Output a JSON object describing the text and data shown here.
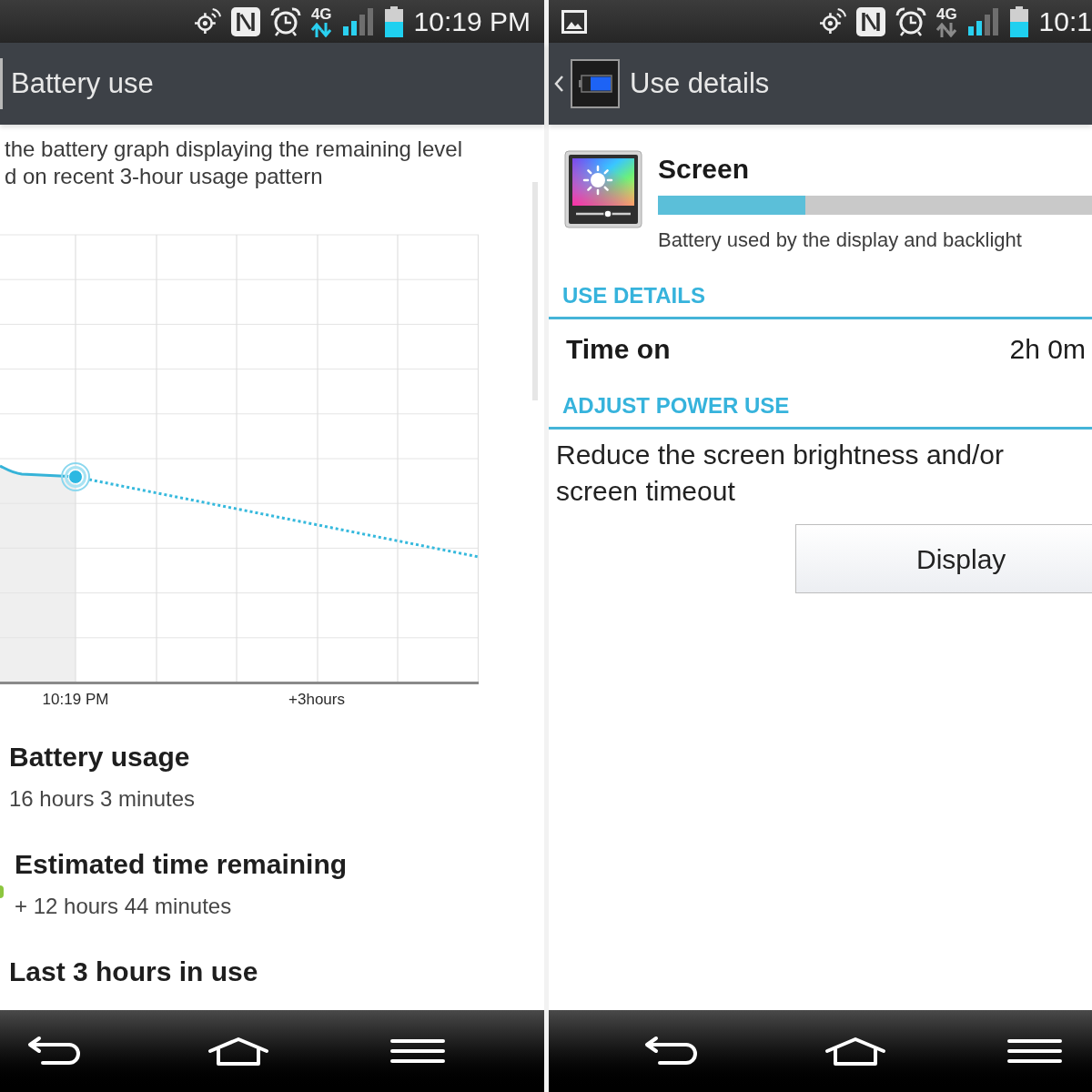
{
  "left_screen": {
    "status_bar": {
      "network": "4G",
      "data_active": true,
      "time": "10:19 PM"
    },
    "header": {
      "title": "Battery use"
    },
    "description_lines": [
      "the battery graph displaying the remaining level",
      "d on recent 3-hour usage pattern"
    ],
    "chart": {
      "x_labels": [
        "10:19 PM",
        "+3hours"
      ]
    },
    "stats": [
      {
        "title": "Battery usage",
        "value": "16 hours 3 minutes"
      },
      {
        "title": "Estimated time remaining",
        "value": "+ 12 hours 44 minutes"
      },
      {
        "title": "Last 3 hours in use"
      }
    ]
  },
  "right_screen": {
    "status_bar": {
      "notification_icon": true,
      "network": "4G",
      "data_active": false,
      "time": "10:1"
    },
    "header": {
      "title": "Use details"
    },
    "app": {
      "name": "Screen",
      "level": 0.34,
      "description": "Battery used by the display and backlight"
    },
    "use_details": {
      "heading": "USE DETAILS",
      "label": "Time on",
      "value": "2h 0m"
    },
    "adjust_power_use": {
      "heading": "ADJUST POWER USE",
      "text": "Reduce the screen brightness and/or screen timeout",
      "button": "Display"
    }
  }
}
